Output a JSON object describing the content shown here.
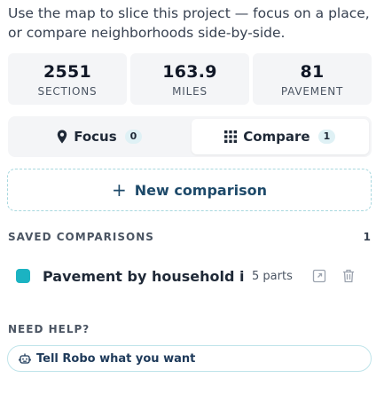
{
  "intro": "Use the map to slice this project — focus on a place, or compare neighborhoods side-by-side.",
  "stats": [
    {
      "value": "2551",
      "label": "SECTIONS"
    },
    {
      "value": "163.9",
      "label": "MILES"
    },
    {
      "value": "81",
      "label": "PAVEMENT"
    }
  ],
  "tabs": {
    "focus": {
      "label": "Focus",
      "count": "0",
      "icon": "map-pin-icon"
    },
    "compare": {
      "label": "Compare",
      "count": "1",
      "icon": "grid-icon",
      "active": true
    }
  },
  "new_comparison": {
    "label": "New comparison",
    "icon": "plus-icon"
  },
  "saved": {
    "heading": "SAVED COMPARISONS",
    "count": "1",
    "items": [
      {
        "name": "Pavement by household in...",
        "parts": "5 parts",
        "color": "#1bb3c2"
      }
    ]
  },
  "help": {
    "heading": "NEED HELP?",
    "button_label": "Tell Robo what you want",
    "icon": "robot-icon"
  },
  "colors": {
    "accent": "#1bb3c2",
    "border": "#a8d8df"
  }
}
